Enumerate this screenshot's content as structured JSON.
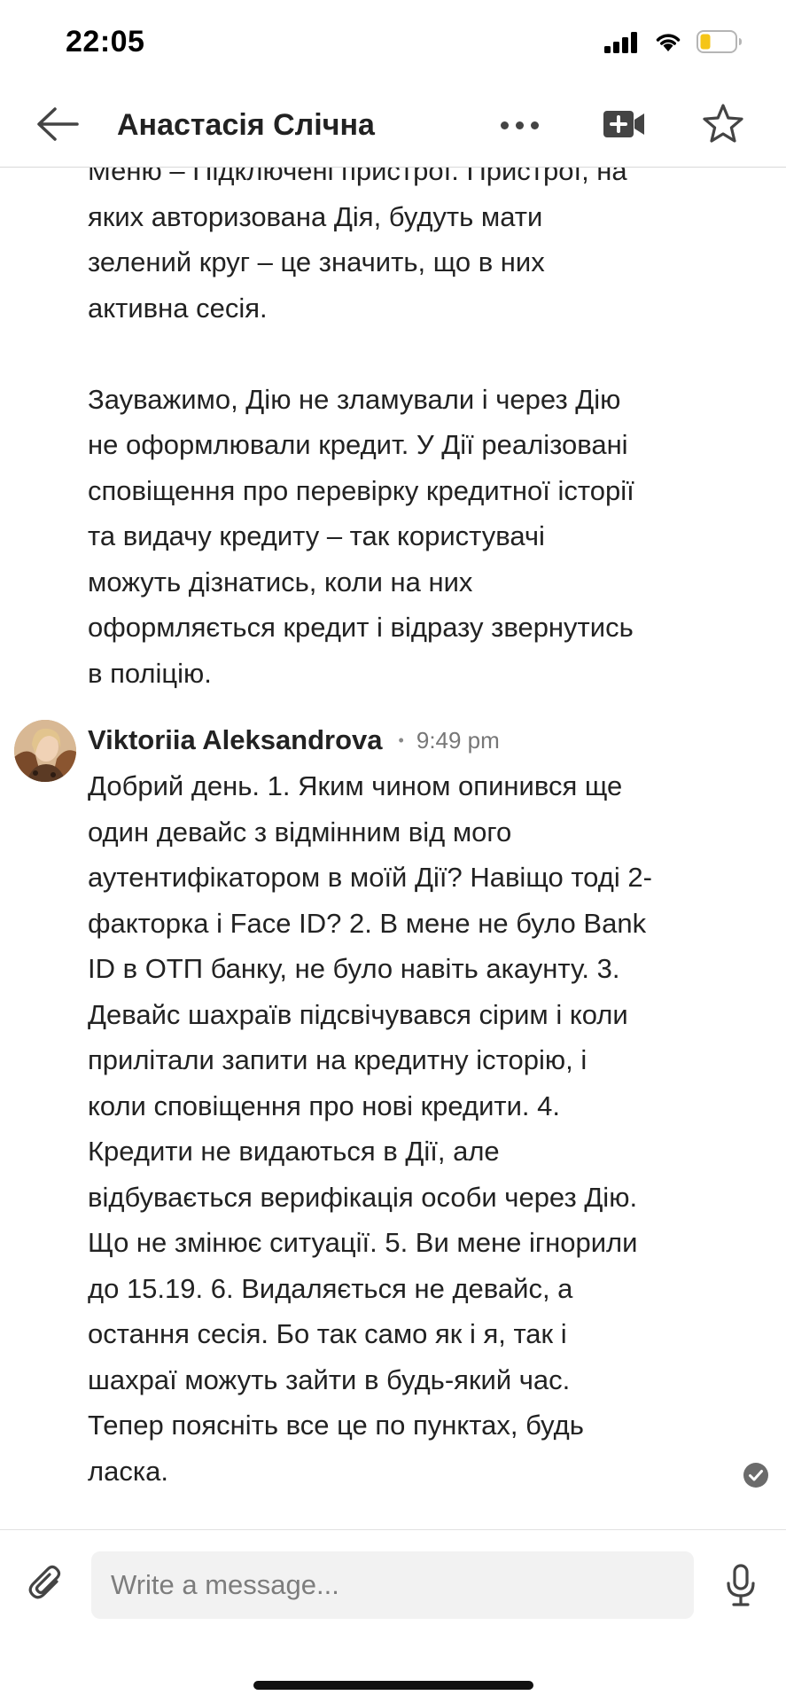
{
  "status_bar": {
    "time": "22:05"
  },
  "header": {
    "contact_name": "Анастасія Слічна"
  },
  "messages": [
    {
      "paragraphs": [
        "Меню – Підключені пристрої. Пристрої, на\nяких авторизована Дія, будуть мати\nзелений круг – це значить, що в них\nактивна сесія.",
        "Зауважимо, Дію не зламували і через Дію\nне оформлювали кредит. У Дії реалізовані\nсповіщення про перевірку кредитної історії\nта видачу кредиту – так користувачі\nможуть дізнатись, коли на них\nоформляється кредит і відразу звернутись\nв поліцію."
      ]
    },
    {
      "sender": "Viktoriia Aleksandrova",
      "separator": "•",
      "time": "9:49 pm",
      "text": "Добрий день. 1. Яким чином опинився ще\nодин девайс з відмінним від мого\nаутентифікатором в моїй Дії? Навіщо тоді 2-\nфакторка і Face ID? 2. В мене не було Bank\nID в ОТП банку, не було навіть акаунту. 3.\nДевайс шахраїв підсвічувався сірим і коли\nприлітали запити на кредитну історію, і\nколи сповіщення про нові кредити. 4.\nКредити не видаються в Дії, але\nвідбувається верифікація особи через Дію.\nЩо не змінює ситуації. 5. Ви мене ігнорили\nдо 15.19. 6. Видаляється не девайс, а\nостання сесія. Бо так само як і я, так і\nшахраї можуть зайти в будь-який час.\nТепер поясніть все це по пунктах, будь\nласка.",
      "status_icon": "read-check-icon"
    }
  ],
  "composer": {
    "placeholder": "Write a message..."
  },
  "icons": {
    "back": "arrow-left-icon",
    "more": "more-dots-icon",
    "video": "video-add-icon",
    "star": "star-outline-icon",
    "attach": "paperclip-icon",
    "mic": "microphone-icon"
  },
  "colors": {
    "battery_level": "#f5c518",
    "read_check": "#6b6b6b"
  }
}
